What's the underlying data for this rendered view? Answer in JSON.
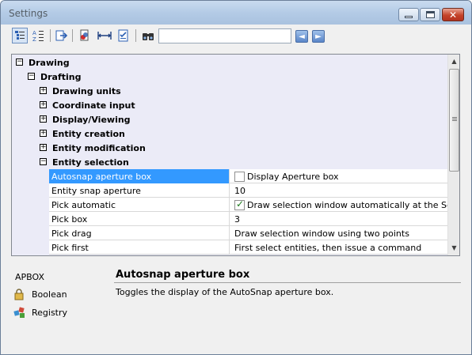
{
  "window": {
    "title": "Settings"
  },
  "window_controls": {
    "minimize": "minimize",
    "maximize": "maximize",
    "close": "✕"
  },
  "toolbar": {
    "search_value": "",
    "icons": [
      "categorized-view-icon",
      "alphabetical-view-icon",
      "export-icon",
      "color-icon",
      "dimension-icon",
      "checklist-icon",
      "find-icon"
    ],
    "prev_icon": "◄",
    "next_icon": "►"
  },
  "tree": {
    "expand_plus": "+",
    "expand_minus": "−",
    "groups": [
      {
        "label": "Drawing",
        "expanded": true
      },
      {
        "label": "Drafting",
        "expanded": true
      },
      {
        "label": "Drawing units",
        "expanded": false
      },
      {
        "label": "Coordinate input",
        "expanded": false
      },
      {
        "label": "Display/Viewing",
        "expanded": false
      },
      {
        "label": "Entity creation",
        "expanded": false
      },
      {
        "label": "Entity modification",
        "expanded": false
      },
      {
        "label": "Entity selection",
        "expanded": true
      }
    ],
    "properties": [
      {
        "name": "Autosnap aperture box",
        "value": "Display Aperture box",
        "checkbox": true,
        "checked": false,
        "selected": true
      },
      {
        "name": "Entity snap aperture",
        "value": "10"
      },
      {
        "name": "Pick automatic",
        "value": "Draw selection window automatically at the Select Entities prompt",
        "checkbox": true,
        "checked": true
      },
      {
        "name": "Pick box",
        "value": "3"
      },
      {
        "name": "Pick drag",
        "value": "Draw selection window using two points"
      },
      {
        "name": "Pick first",
        "value": "First select entities, then issue a command"
      }
    ]
  },
  "details": {
    "variable": "APBOX",
    "type": "Boolean",
    "storage": "Registry",
    "title": "Autosnap aperture box",
    "description": "Toggles the display of the AutoSnap aperture box."
  },
  "colors": {
    "selection": "#3399ff",
    "tree_bg": "#ebebf7",
    "titlebar": "#b4cbe6"
  }
}
